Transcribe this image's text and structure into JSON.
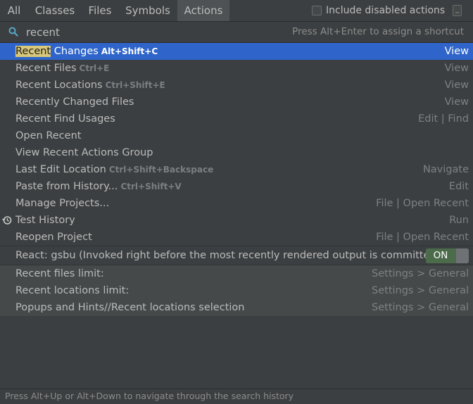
{
  "tabs": [
    {
      "label": "All"
    },
    {
      "label": "Classes"
    },
    {
      "label": "Files"
    },
    {
      "label": "Symbols"
    },
    {
      "label": "Actions"
    }
  ],
  "include_disabled": {
    "label": "Include disabled actions",
    "checked": false
  },
  "search": {
    "value": "recent",
    "hint": "Press Alt+Enter to assign a shortcut"
  },
  "results": [
    {
      "highlight": "Recent",
      "rest": " Changes",
      "shortcut": "Alt+Shift+C",
      "group": "View",
      "selected": true
    },
    {
      "highlight": "",
      "rest": "Recent Files",
      "shortcut": "Ctrl+E",
      "group": "View"
    },
    {
      "highlight": "",
      "rest": "Recent Locations",
      "shortcut": "Ctrl+Shift+E",
      "group": "View"
    },
    {
      "highlight": "",
      "rest": "Recently Changed Files",
      "shortcut": "",
      "group": "View"
    },
    {
      "highlight": "",
      "rest": "Recent Find Usages",
      "shortcut": "",
      "group": "Edit | Find"
    },
    {
      "highlight": "",
      "rest": "Open Recent",
      "shortcut": "",
      "group": ""
    },
    {
      "highlight": "",
      "rest": "View Recent Actions Group",
      "shortcut": "",
      "group": ""
    },
    {
      "highlight": "",
      "rest": "Last Edit Location",
      "shortcut": "Ctrl+Shift+Backspace",
      "group": "Navigate"
    },
    {
      "highlight": "",
      "rest": "Paste from History...",
      "shortcut": "Ctrl+Shift+V",
      "group": "Edit"
    },
    {
      "highlight": "",
      "rest": "Manage Projects...",
      "shortcut": "",
      "group": "File | Open Recent"
    },
    {
      "highlight": "",
      "rest": "Test History",
      "shortcut": "",
      "group": "Run",
      "icon": "history-clock-icon"
    },
    {
      "highlight": "",
      "rest": "Reopen Project",
      "shortcut": "",
      "group": "File | Open Recent"
    }
  ],
  "toggle_option": {
    "label": "React: gsbu (Invoked right before the most recently rendered output is committed...",
    "state": "ON"
  },
  "settings": [
    {
      "label": "Recent files limit:",
      "group": "Settings > General"
    },
    {
      "label": "Recent locations limit:",
      "group": "Settings > General"
    },
    {
      "label": "Popups and Hints//Recent locations selection",
      "group": "Settings > General"
    }
  ],
  "status": {
    "text": "Press Alt+Up or Alt+Down to navigate through the search history"
  },
  "colors": {
    "selection": "#2f65ca",
    "highlight": "#d9c87a",
    "background": "#3c3f41",
    "toggle_on": "#4b6b4b"
  }
}
